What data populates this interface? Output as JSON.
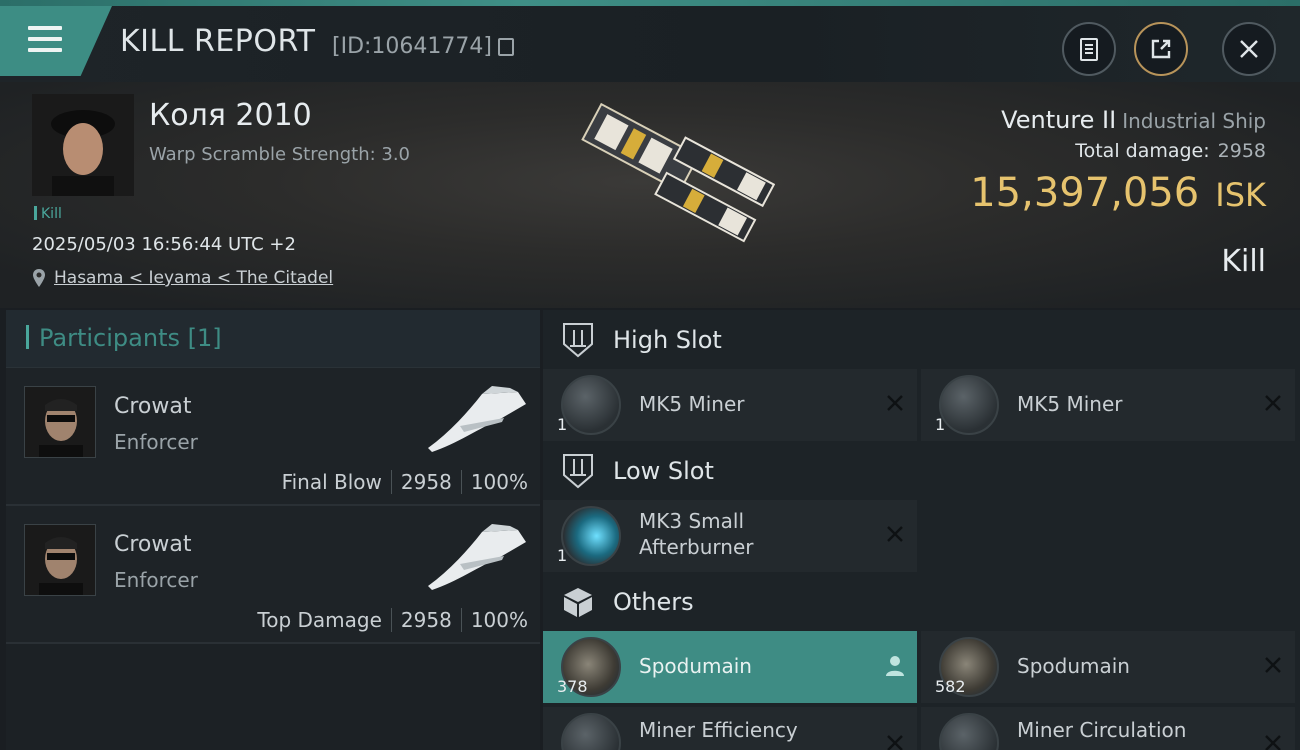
{
  "header": {
    "title": "KILL REPORT",
    "report_id": "[ID:10641774]"
  },
  "victim": {
    "pilot_name": "Коля 2010",
    "warp_scramble": "Warp Scramble Strength: 3.0",
    "kill_tag": "Kill",
    "datetime": "2025/05/03 16:56:44 UTC +2",
    "location": "Hasama < Ieyama < The Citadel",
    "ship_name": "Venture II",
    "ship_class": "Industrial Ship",
    "total_damage_label": "Total damage:",
    "total_damage_value": "2958",
    "isk_value": "15,397,056",
    "isk_unit": "ISK",
    "result": "Kill"
  },
  "participants": {
    "header": "Participants [1]",
    "rows": [
      {
        "name": "Crowat",
        "ship": "Enforcer",
        "label": "Final Blow",
        "damage": "2958",
        "percent": "100%"
      },
      {
        "name": "Crowat",
        "ship": "Enforcer",
        "label": "Top Damage",
        "damage": "2958",
        "percent": "100%"
      }
    ]
  },
  "fitting": {
    "high_slot": {
      "label": "High Slot",
      "items": [
        {
          "name": "MK5 Miner",
          "qty": "1"
        },
        {
          "name": "MK5 Miner",
          "qty": "1"
        }
      ]
    },
    "low_slot": {
      "label": "Low Slot",
      "items": [
        {
          "name_line1": "MK3 Small",
          "name_line2": "Afterburner",
          "qty": "1"
        }
      ]
    },
    "others": {
      "label": "Others",
      "items": [
        {
          "name": "Spodumain",
          "qty": "378"
        },
        {
          "name": "Spodumain",
          "qty": "582"
        },
        {
          "name": "Miner Efficiency"
        },
        {
          "name": "Miner Circulation"
        }
      ]
    }
  },
  "colors": {
    "accent": "#3e8c84",
    "isk": "#e6c36e"
  },
  "icons": [
    "menu-icon",
    "copy-icon",
    "clipboard-icon",
    "share-icon",
    "close-icon",
    "location-pin-icon",
    "high-slot-icon",
    "low-slot-icon",
    "cargo-box-icon",
    "remove-x-icon",
    "user-icon"
  ]
}
